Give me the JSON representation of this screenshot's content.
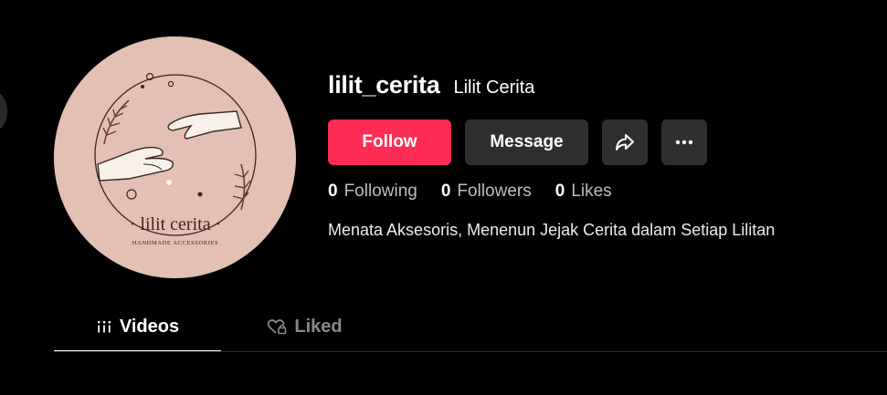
{
  "profile": {
    "username": "lilit_cerita",
    "nickname": "Lilit Cerita",
    "bio": "Menata Aksesoris, Menenun Jejak Cerita dalam Setiap Lilitan",
    "avatar_logo_text": "· lilit cerita ·",
    "avatar_logo_subtext": "HANDMADE ACCESSORIES"
  },
  "actions": {
    "follow_label": "Follow",
    "message_label": "Message",
    "share_icon": "share-arrow-icon",
    "more_icon": "ellipsis-icon"
  },
  "stats": {
    "following_count": "0",
    "following_label": "Following",
    "followers_count": "0",
    "followers_label": "Followers",
    "likes_count": "0",
    "likes_label": "Likes"
  },
  "tabs": [
    {
      "label": "Videos",
      "icon": "grid-icon",
      "active": true
    },
    {
      "label": "Liked",
      "icon": "heart-lock-icon",
      "active": false
    }
  ],
  "colors": {
    "accent": "#fe2c55",
    "background": "#000000",
    "button_secondary": "#2f2f2f",
    "avatar_bg": "#e4bfb4"
  }
}
